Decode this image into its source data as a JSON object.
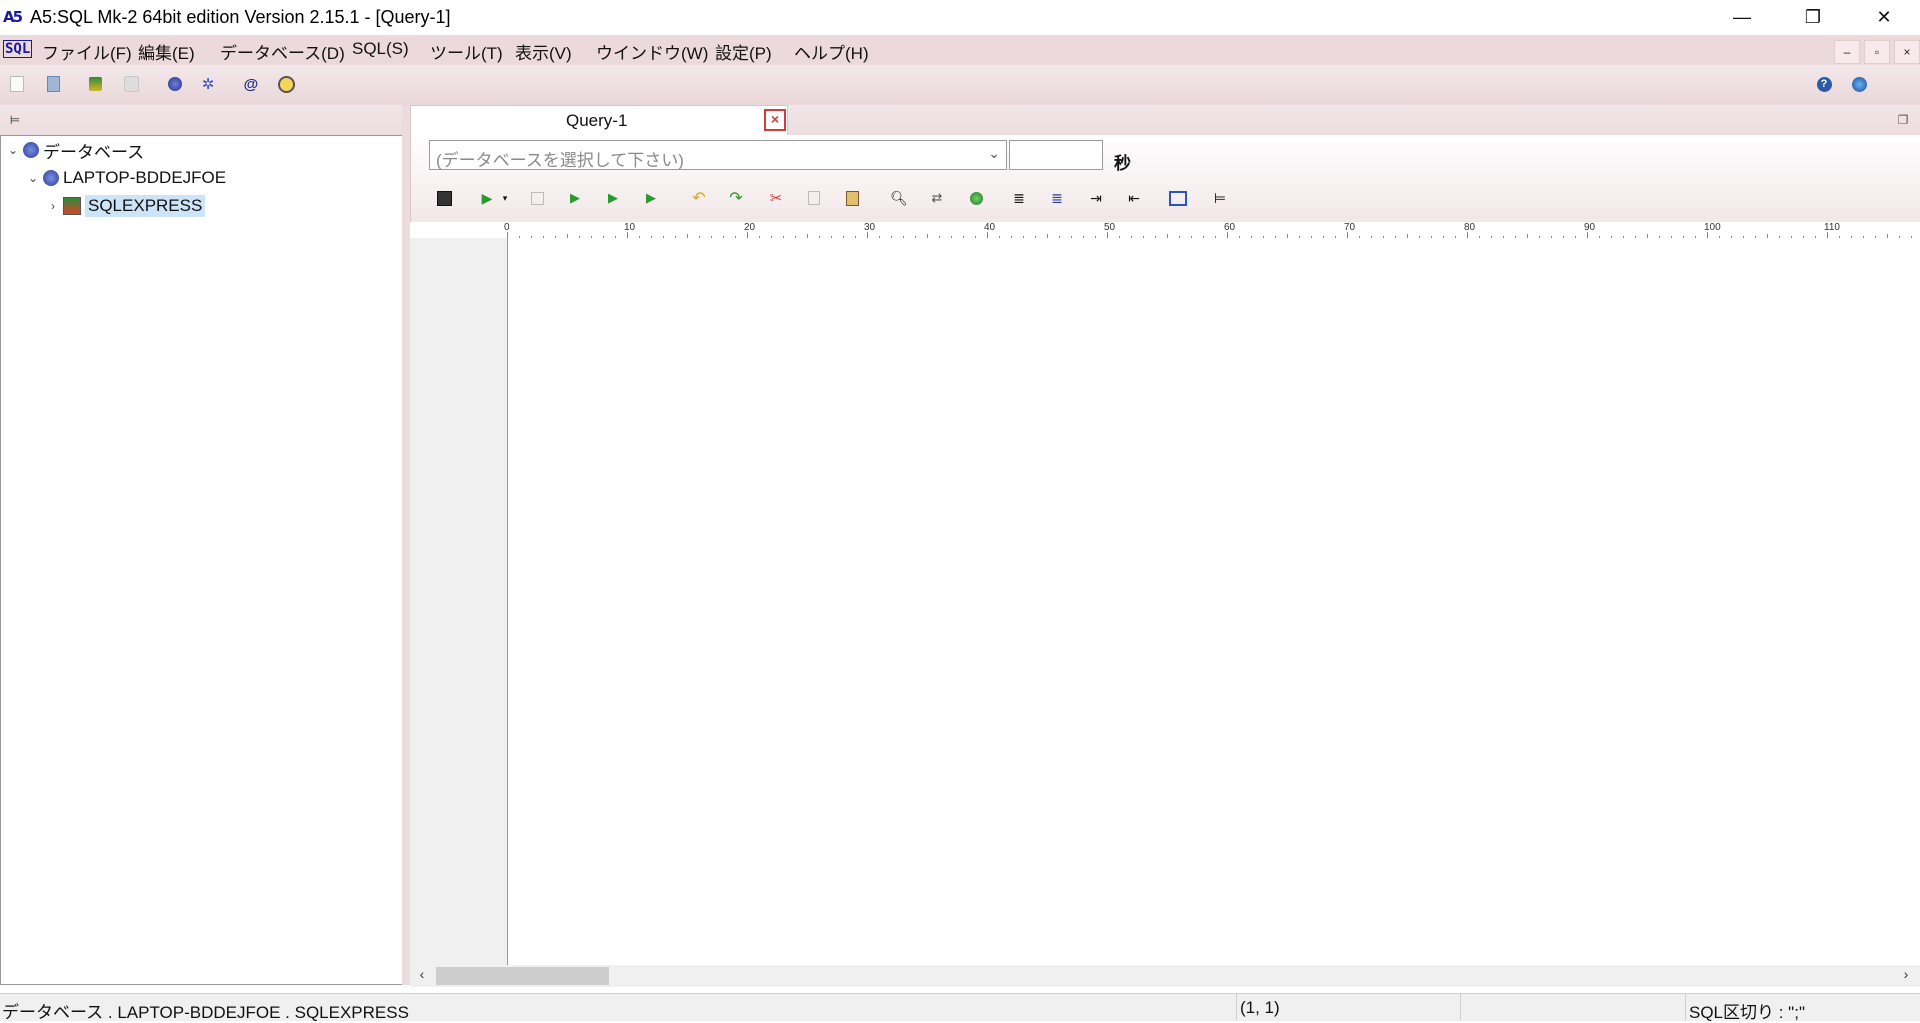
{
  "window": {
    "title": "A5:SQL Mk-2 64bit edition Version 2.15.1 - [Query-1]",
    "logo": "A5",
    "controls": [
      "—",
      "❐",
      "✕"
    ]
  },
  "menu": {
    "sql_logo": "SQL",
    "items": [
      "ファイル(F)",
      "編集(E)",
      "データベース(D)",
      "SQL(S)",
      "ツール(T)",
      "表示(V)",
      "ウインドウ(W)",
      "設定(P)",
      "ヘルプ(H)"
    ],
    "mdi_controls": [
      "–",
      "▫",
      "×"
    ]
  },
  "tree": {
    "root": "データベース",
    "server": "LAPTOP-BDDEJFOE",
    "instance": "SQLEXPRESS"
  },
  "tabs": {
    "query": "Query-1"
  },
  "query": {
    "db_placeholder": "(データベースを選択して下さい)",
    "timeout_value": "",
    "timeout_unit": "秒"
  },
  "ruler": {
    "labels": [
      "0",
      "10",
      "20",
      "30",
      "40",
      "50",
      "60",
      "70",
      "80",
      "90",
      "100",
      "110"
    ]
  },
  "status": {
    "path": "データベース . LAPTOP-BDDEJFOE . SQLEXPRESS",
    "position": "(1, 1)",
    "delimiter": "SQL区切り : \";\""
  },
  "colors": {
    "chrome": "#ecd9dc",
    "accent_close": "#d23c3c",
    "db_icon": "#2a3c9a"
  }
}
